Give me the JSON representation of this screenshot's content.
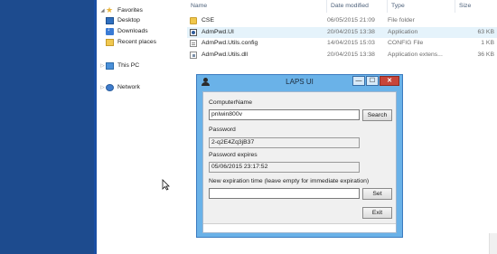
{
  "nav": {
    "items": [
      {
        "label": "Favorites",
        "icon": "star-icon"
      },
      {
        "label": "Desktop",
        "icon": "desktop-icon"
      },
      {
        "label": "Downloads",
        "icon": "downloads-icon"
      },
      {
        "label": "Recent places",
        "icon": "recent-places-icon"
      },
      {
        "label": "This PC",
        "icon": "computer-icon"
      },
      {
        "label": "Network",
        "icon": "network-icon"
      }
    ]
  },
  "filelist": {
    "columns": [
      "Name",
      "Date modified",
      "Type",
      "Size"
    ],
    "rows": [
      {
        "name": "CSE",
        "date": "06/05/2015 21:09",
        "type": "File folder",
        "size": "",
        "icon": "folder-icon"
      },
      {
        "name": "AdmPwd.UI",
        "date": "20/04/2015 13:38",
        "type": "Application",
        "size": "63 KB",
        "icon": "application-icon"
      },
      {
        "name": "AdmPwd.Utils.config",
        "date": "14/04/2015 15:03",
        "type": "CONFIG File",
        "size": "1 KB",
        "icon": "config-file-icon"
      },
      {
        "name": "AdmPwd.Utils.dll",
        "date": "20/04/2015 13:38",
        "type": "Application extens...",
        "size": "36 KB",
        "icon": "dll-file-icon"
      }
    ]
  },
  "laps": {
    "title": "LAPS UI",
    "computer_name_label": "ComputerName",
    "computer_name_value": "pnlwin800v",
    "search_label": "Search",
    "password_label": "Password",
    "password_value": "2-q2E4Zq3jB37",
    "expires_label": "Password expires",
    "expires_value": "05/06/2015 23:17:52",
    "new_expiration_label": "New expiration time (leave empty for immediate expiration)",
    "new_expiration_value": "",
    "set_label": "Set",
    "exit_label": "Exit",
    "minimize_glyph": "—",
    "maximize_glyph": "☐",
    "close_glyph": "✕"
  }
}
